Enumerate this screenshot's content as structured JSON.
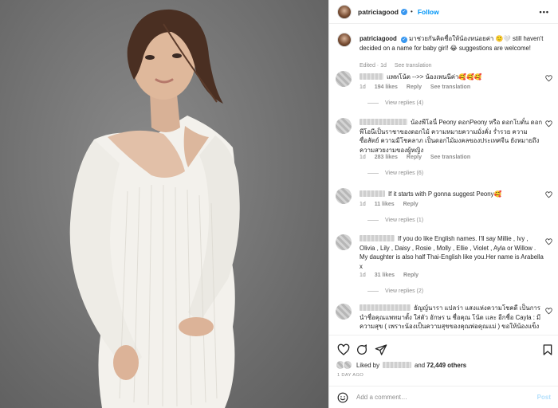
{
  "post": {
    "username": "patriciagood",
    "follow_label": "Follow",
    "dot": "•",
    "more": "•••",
    "verified_mark": "✓"
  },
  "caption": {
    "text": "มาช่วยกันคิดชื่อให้น้องหน่อยค่า 🙂🤍 still haven't decided on a name for baby girl! 😂 suggestions are welcome!",
    "edited": "Edited · 1d",
    "see_translation": "See translation"
  },
  "comments": [
    {
      "text": "แพทโน้ต -->> น้องเพนนีค่า🥰🥰🥰",
      "time": "1d",
      "likes": "194 likes",
      "reply": "Reply",
      "translation": "See translation",
      "view_replies": "View replies (4)"
    },
    {
      "text": "น้องพีโอนี่ Peony ดอกPeony หรือ ดอกโบตั๋น ดอกพีโอนีเป็นราชาของดอกไม้ ความหมายความมั่งคั่ง ร่ำรวย ความซื่อสัตย์ ความมีโชคลาภ เป็นดอกไม้มงคลของประเทศจีน ยังหมายถึงความสวยงามของผู้หญิง",
      "time": "1d",
      "likes": "283 likes",
      "reply": "Reply",
      "translation": "See translation",
      "view_replies": "View replies (6)"
    },
    {
      "text": "If it starts with P gonna suggest Peony🥰",
      "time": "1d",
      "likes": "11 likes",
      "reply": "Reply",
      "view_replies": "View replies (1)"
    },
    {
      "text": "If you do like English names. I'll say Millie , Ivy , Olivia , Lily , Daisy , Rosie , Molly , Ellie , Violet , Ayla or Willow . My daughter is also half Thai-English like you.Her name is Arabella x",
      "time": "1d",
      "likes": "31 likes",
      "reply": "Reply",
      "view_replies": "View replies (2)"
    },
    {
      "text": "ธัญญ์นารา แปลว่า แสงแห่งความโชคดี เป็นการนำชื่อคุณแพทมาตั้ง ใส่ตัว อักษร น ชื่อคุณ โน้ต และ อีกชื่อ Cayla : มีความสุข ( เพราะน้องเป็นความสุขของคุณพ่อคุณแม่ ) ขอให้น้องแข็ง"
    }
  ],
  "likes_row": {
    "liked_by": "Liked by",
    "and": "and",
    "others": "72,449 others"
  },
  "time_ago": "1 DAY AGO",
  "add_comment": {
    "placeholder": "Add a comment…",
    "post_label": "Post"
  },
  "colors": {
    "accent": "#0095f6",
    "background_photo": "#767676",
    "muted": "#8e8e8e"
  }
}
